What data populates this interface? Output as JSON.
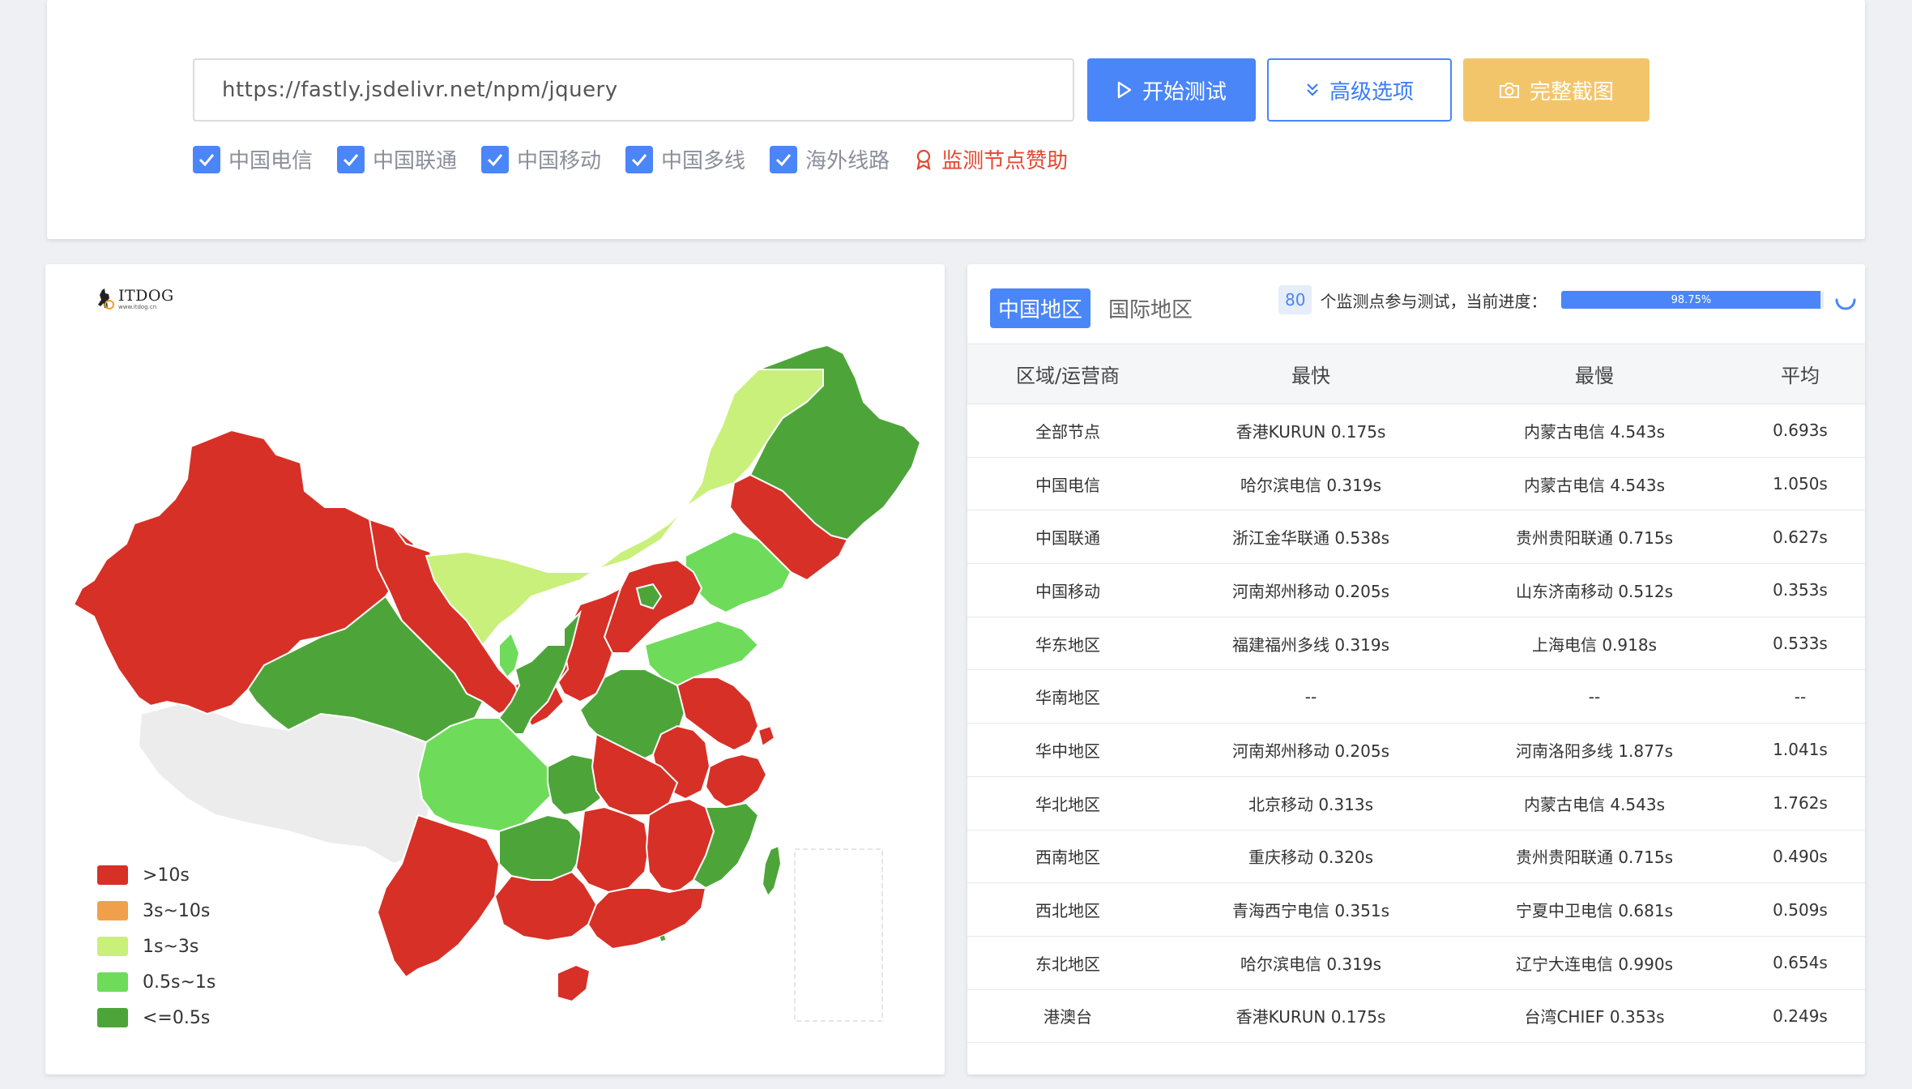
{
  "search": {
    "url_value": "https://fastly.jsdelivr.net/npm/jquery"
  },
  "buttons": {
    "start": "开始测试",
    "advanced": "高级选项",
    "capture": "完整截图"
  },
  "carriers": [
    {
      "label": "中国电信",
      "checked": true
    },
    {
      "label": "中国联通",
      "checked": true
    },
    {
      "label": "中国移动",
      "checked": true
    },
    {
      "label": "中国多线",
      "checked": true
    },
    {
      "label": "海外线路",
      "checked": true
    }
  ],
  "sponsor_link": "监测节点赞助",
  "map": {
    "logo_text": "ITDOG",
    "logo_sub": "www.itdog.cn",
    "legend": [
      {
        "label": ">10s",
        "color": "#d73027"
      },
      {
        "label": "3s~10s",
        "color": "#f0a04b"
      },
      {
        "label": "1s~3s",
        "color": "#c9f07a"
      },
      {
        "label": "0.5s~1s",
        "color": "#6edc5a"
      },
      {
        "label": "<=0.5s",
        "color": "#4da53a"
      }
    ]
  },
  "results": {
    "tabs": {
      "china": "中国地区",
      "international": "国际地区"
    },
    "node_count": "80",
    "progress_label": "个监测点参与测试，当前进度：",
    "progress_value": "98.75%",
    "progress_fraction": 0.9875,
    "columns": [
      "区域/运营商",
      "最快",
      "最慢",
      "平均"
    ],
    "rows": [
      [
        "全部节点",
        "香港KURUN 0.175s",
        "内蒙古电信 4.543s",
        "0.693s"
      ],
      [
        "中国电信",
        "哈尔滨电信 0.319s",
        "内蒙古电信 4.543s",
        "1.050s"
      ],
      [
        "中国联通",
        "浙江金华联通 0.538s",
        "贵州贵阳联通 0.715s",
        "0.627s"
      ],
      [
        "中国移动",
        "河南郑州移动 0.205s",
        "山东济南移动 0.512s",
        "0.353s"
      ],
      [
        "华东地区",
        "福建福州多线 0.319s",
        "上海电信 0.918s",
        "0.533s"
      ],
      [
        "华南地区",
        "--",
        "--",
        "--"
      ],
      [
        "华中地区",
        "河南郑州移动 0.205s",
        "河南洛阳多线 1.877s",
        "1.041s"
      ],
      [
        "华北地区",
        "北京移动 0.313s",
        "内蒙古电信 4.543s",
        "1.762s"
      ],
      [
        "西南地区",
        "重庆移动 0.320s",
        "贵州贵阳联通 0.715s",
        "0.490s"
      ],
      [
        "西北地区",
        "青海西宁电信 0.351s",
        "宁夏中卫电信 0.681s",
        "0.509s"
      ],
      [
        "东北地区",
        "哈尔滨电信 0.319s",
        "辽宁大连电信 0.990s",
        "0.654s"
      ],
      [
        "港澳台",
        "香港KURUN 0.175s",
        "台湾CHIEF 0.353s",
        "0.249s"
      ]
    ]
  },
  "colors": {
    "accent": "#4a86f7",
    "capture_button": "#f3c56b",
    "sponsor": "#e5462f",
    "no_data": "#ececec"
  }
}
